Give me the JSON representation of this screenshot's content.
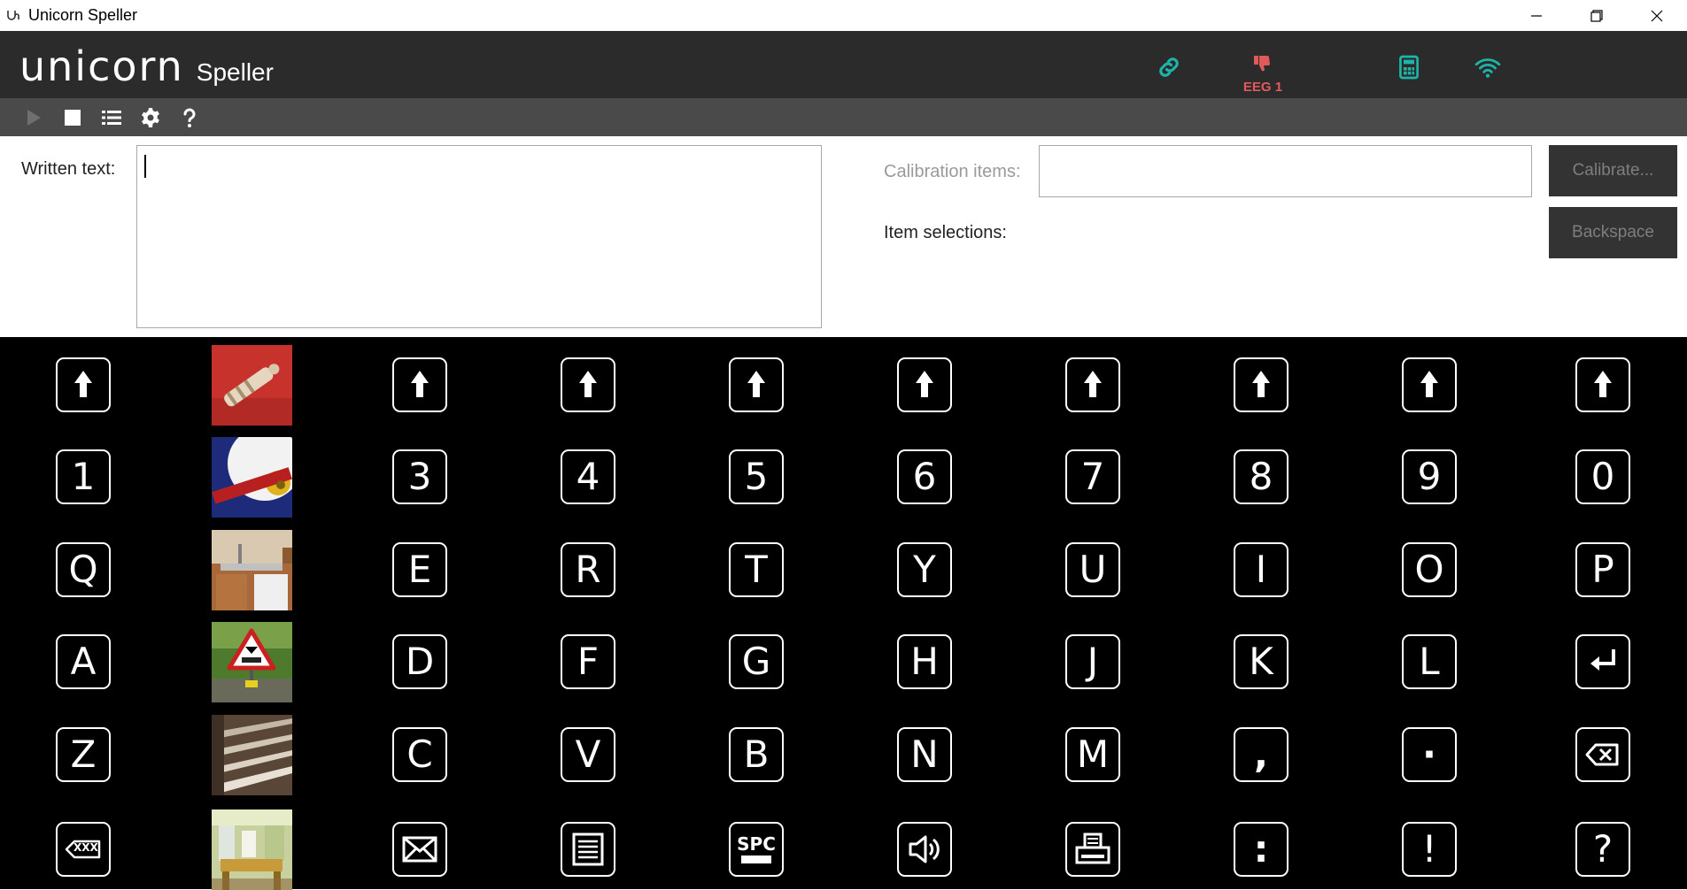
{
  "window": {
    "title": "Unicorn Speller"
  },
  "header": {
    "brand": "unicorn",
    "product": "Speller",
    "eeg_label": "EEG 1",
    "icons": [
      "link-icon",
      "thumbs-down-icon",
      "calculator-icon",
      "wifi-icon"
    ],
    "accent_color": "#1cb5a8",
    "alert_color": "#e05a5a"
  },
  "toolbar": {
    "icons": [
      "play-icon",
      "stop-icon",
      "list-icon",
      "gear-icon",
      "help-icon"
    ]
  },
  "form": {
    "written_text_label": "Written text:",
    "written_text_value": "",
    "calibration_label": "Calibration items:",
    "calibration_value": "",
    "item_selections_label": "Item selections:",
    "calibrate_button": "Calibrate...",
    "backspace_button": "Backspace"
  },
  "matrix": {
    "rows": [
      [
        "shift",
        "photo-whistle",
        "shift",
        "shift",
        "shift",
        "shift",
        "shift",
        "shift",
        "shift",
        "shift"
      ],
      [
        "1",
        "photo-wheel",
        "3",
        "4",
        "5",
        "6",
        "7",
        "8",
        "9",
        "0"
      ],
      [
        "Q",
        "photo-kitchen",
        "E",
        "R",
        "T",
        "Y",
        "U",
        "I",
        "O",
        "P"
      ],
      [
        "A",
        "photo-roadsign",
        "D",
        "F",
        "G",
        "H",
        "J",
        "K",
        "L",
        "enter"
      ],
      [
        "Z",
        "photo-stairs",
        "C",
        "V",
        "B",
        "N",
        "M",
        ",",
        "·",
        "backspace"
      ],
      [
        "delete-word",
        "photo-room",
        "mail",
        "document",
        "space",
        "speaker",
        "print",
        ":",
        "!",
        "?"
      ]
    ],
    "space_label": "SPC",
    "delete_word_label": "XXX"
  }
}
